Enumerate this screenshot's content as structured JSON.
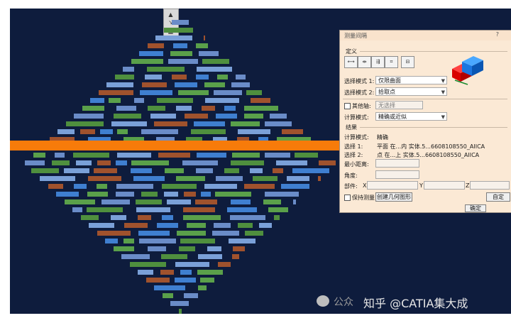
{
  "dialog": {
    "title": "测量间隔",
    "help": "?",
    "definition_group": "定义",
    "mode_icons": [
      "measure-between-icon",
      "measure-chain-icon",
      "measure-fan-icon",
      "measure-item-icon",
      "measure-thickness-icon"
    ],
    "selection_mode_1_label": "选择模式 1:",
    "selection_mode_1_value": "仅限曲面",
    "selection_mode_2_label": "选择模式 2:",
    "selection_mode_2_value": "拾取点",
    "other_axis_label": "其他轴:",
    "other_axis_value": "无选择",
    "calc_mode_label": "计算模式:",
    "calc_mode_value": "精确或近似",
    "result_group": "结果",
    "result_calc_mode_label": "计算模式:",
    "result_calc_mode_value": "精确",
    "result_sel1_label": "选择 1:",
    "result_sel1_value": "平面 在...内 实体.5...6608108550_AIICA",
    "result_sel2_label": "选择 2:",
    "result_sel2_value": "点 在...上 实体.5...6608108550_AIICA",
    "min_distance_label": "最小距离:",
    "angle_label": "角度:",
    "component_label": "部件:",
    "x_label": "X",
    "y_label": "Y",
    "z_label": "Z",
    "keep_measure_label": "保持测量",
    "create_geometry_button": "创建几何图形",
    "custom_button": "自定",
    "apply_button": "确定"
  },
  "watermark": {
    "prefix": "公众",
    "text": "知乎 @CATIA集大成"
  },
  "colors": {
    "viewport_bg": "#0e1c3d",
    "highlight_band": "#f77b0a",
    "dialog_bg": "#fbe9d5"
  }
}
